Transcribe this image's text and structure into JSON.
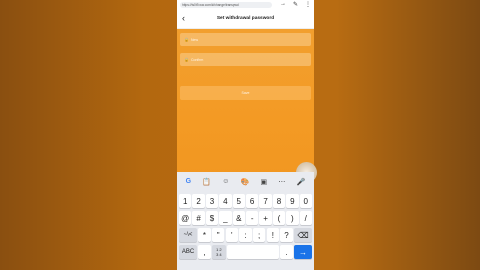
{
  "browser": {
    "url": "https://ts0t9-ww.com/#/change/transpwd",
    "icons": [
      "home-icon",
      "tab-count-icon",
      "more-icon"
    ]
  },
  "header": {
    "back": "‹",
    "title": "Set withdrawal password"
  },
  "form": {
    "field1_placeholder": "New",
    "field2_placeholder": "Confirm",
    "submit_label": "Save"
  },
  "keyboard": {
    "toolbar": [
      "G",
      "clipboard",
      "emoji",
      "palette",
      "screenshot",
      "more",
      "mic"
    ],
    "row1": [
      "1",
      "2",
      "3",
      "4",
      "5",
      "6",
      "7",
      "8",
      "9",
      "0"
    ],
    "row2": [
      "@",
      "#",
      "$",
      "_",
      "&",
      "-",
      "+",
      "(",
      ")",
      "/"
    ],
    "row3": [
      "~\\<",
      "*",
      "\"",
      "'",
      ":",
      ";",
      "!",
      "?",
      "⌫"
    ],
    "row4": [
      "ABC",
      ",",
      "1 2\n3 4",
      "space",
      ".",
      "→"
    ]
  }
}
